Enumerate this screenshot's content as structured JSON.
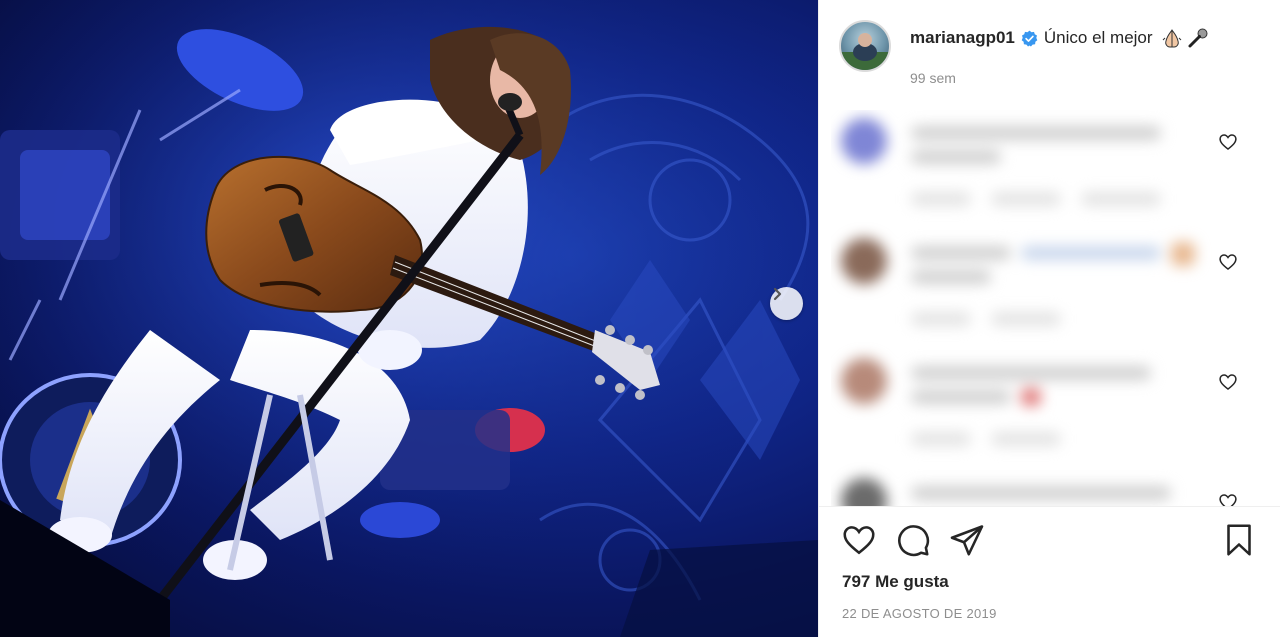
{
  "post": {
    "username": "marianagp01",
    "caption": "Único el mejor",
    "caption_emoji": [
      "praying-hands-emoji",
      "microphone-emoji"
    ],
    "age": "99 sem",
    "verified": true
  },
  "comments": [
    {
      "state": "blurred",
      "avatar_color": "#7f86d6"
    },
    {
      "state": "blurred",
      "avatar_color": "#8a6a5a"
    },
    {
      "state": "blurred",
      "avatar_color": "#b78a7a"
    },
    {
      "state": "blurred",
      "avatar_color": "#6b6b6b"
    }
  ],
  "actions": {
    "like_icon": "heart-icon",
    "comment_icon": "comment-icon",
    "share_icon": "share-icon",
    "save_icon": "bookmark-icon"
  },
  "likes": "797 Me gusta",
  "date": "22 DE AGOSTO DE 2019",
  "photo": {
    "description_icon": "concert-photo",
    "next_icon": "chevron-right-icon"
  },
  "colors": {
    "stage_blue": "#10268a",
    "verified_blue": "#3897f0",
    "text": "#262626",
    "muted": "#8e8e8e"
  }
}
